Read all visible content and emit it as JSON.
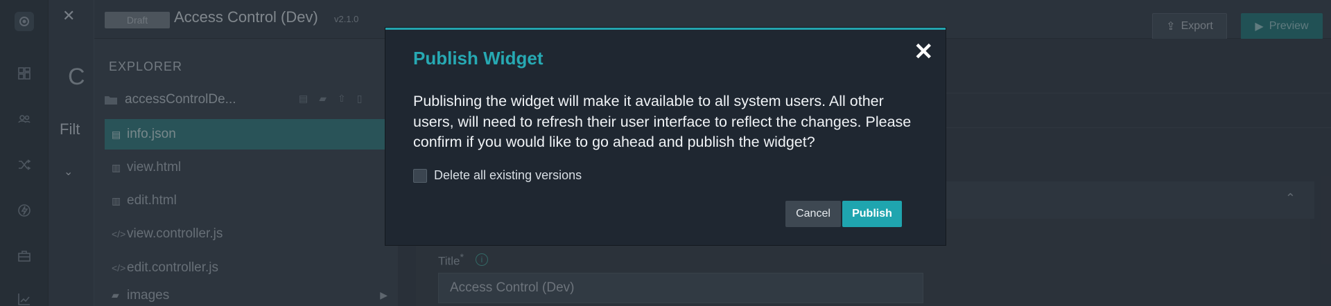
{
  "header": {
    "draft_badge": "Draft",
    "title": "Access Control (Dev)",
    "version": "v2.1.0",
    "export_label": "Export",
    "preview_label": "Preview"
  },
  "strip": {
    "filter_text": "Filt"
  },
  "explorer": {
    "title": "EXPLORER",
    "folder_name": "accessControlDe...",
    "files": [
      {
        "name": "info.json",
        "icon": "json-file-icon"
      },
      {
        "name": "view.html",
        "icon": "html-file-icon"
      },
      {
        "name": "edit.html",
        "icon": "html-file-icon"
      },
      {
        "name": "view.controller.js",
        "icon": "code-file-icon"
      },
      {
        "name": "edit.controller.js",
        "icon": "code-file-icon"
      },
      {
        "name": "images",
        "icon": "folder-icon"
      }
    ]
  },
  "form": {
    "title_label": "Title",
    "title_required_mark": "*",
    "title_value": "Access Control (Dev)"
  },
  "modal": {
    "title": "Publish Widget",
    "body": "Publishing the widget will make it available to all system users. All other users, will need to refresh their user interface to reflect the changes. Please confirm if you would like to go ahead and publish the widget?",
    "checkbox_label": "Delete all existing versions",
    "checkbox_checked": false,
    "cancel_label": "Cancel",
    "publish_label": "Publish"
  },
  "colors": {
    "accent": "#23a4ae",
    "modal_bg": "#1f2731",
    "publish_bg": "#1fa5af"
  }
}
